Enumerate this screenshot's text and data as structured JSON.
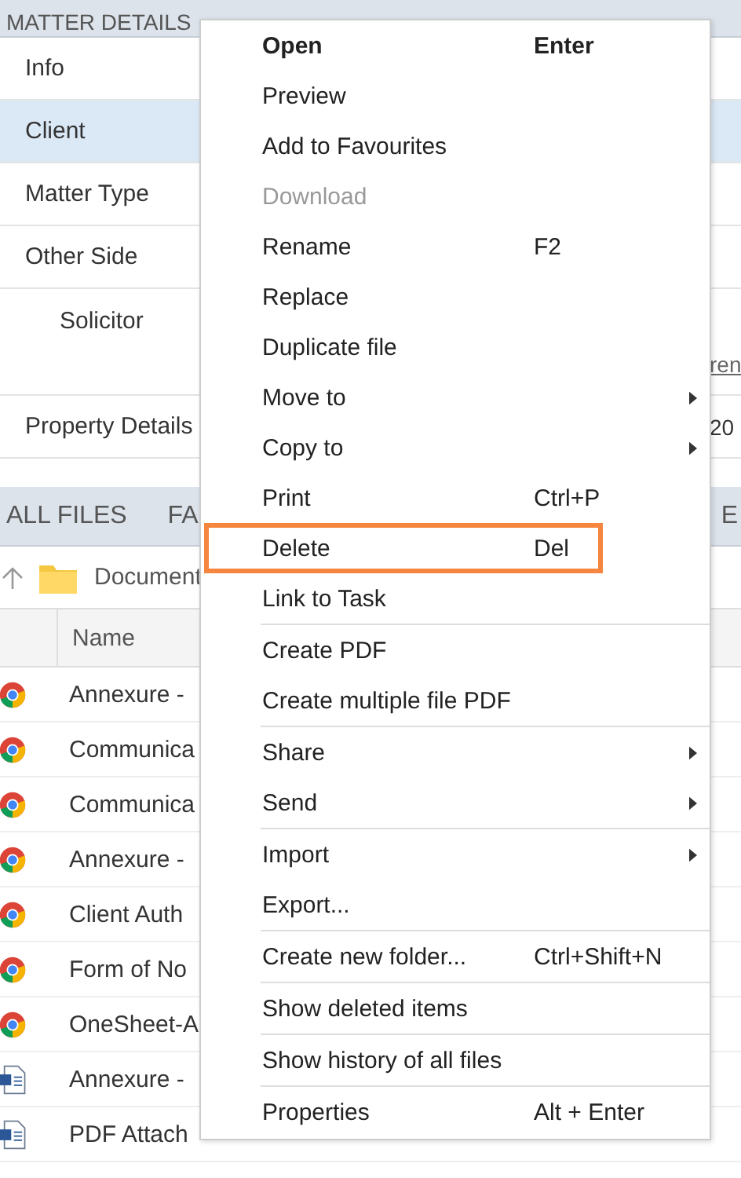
{
  "matter_details": {
    "title": "MATTER DETAILS",
    "rows": [
      {
        "label": "Info",
        "selected": false
      },
      {
        "label": "Client",
        "selected": true
      },
      {
        "label": "Matter Type",
        "selected": false
      },
      {
        "label": "Other Side",
        "selected": false
      },
      {
        "label": "Solicitor",
        "selected": false,
        "kind": "sub",
        "value": "ren",
        "underlined": true
      },
      {
        "label": "Property Details",
        "selected": false,
        "kind": "main",
        "value": "20",
        "underlined": false
      }
    ]
  },
  "files": {
    "tabs": [
      {
        "label": "ALL FILES",
        "selected": false
      },
      {
        "label": "FA",
        "selected": false
      },
      {
        "label": "E",
        "selected": false
      }
    ],
    "breadcrumb": "Document",
    "columns": [
      "Name"
    ],
    "rows": [
      {
        "name": "Annexure -",
        "kind": "browser"
      },
      {
        "name": "Communica",
        "kind": "browser"
      },
      {
        "name": "Communica",
        "kind": "browser"
      },
      {
        "name": "Annexure -",
        "kind": "browser"
      },
      {
        "name": "Client Auth",
        "kind": "browser"
      },
      {
        "name": "Form of No",
        "kind": "browser"
      },
      {
        "name": "OneSheet-A",
        "kind": "browser"
      },
      {
        "name": "Annexure -",
        "kind": "word"
      },
      {
        "name": "PDF Attach",
        "kind": "word"
      }
    ]
  },
  "context_menu": {
    "groups": [
      [
        {
          "label": "Open",
          "shortcut": "Enter",
          "default": true,
          "disabled": false,
          "submenu": false,
          "highlighted": false
        },
        {
          "label": "Preview",
          "default": false,
          "disabled": false,
          "submenu": false,
          "highlighted": false
        },
        {
          "label": "Add to Favourites",
          "default": false,
          "disabled": false,
          "submenu": false,
          "highlighted": false
        },
        {
          "label": "Download",
          "default": false,
          "disabled": true,
          "submenu": false,
          "highlighted": false
        },
        {
          "label": "Rename",
          "shortcut": "F2",
          "default": false,
          "disabled": false,
          "submenu": false,
          "highlighted": false
        },
        {
          "label": "Replace",
          "default": false,
          "disabled": false,
          "submenu": false,
          "highlighted": false
        },
        {
          "label": "Duplicate file",
          "default": false,
          "disabled": false,
          "submenu": false,
          "highlighted": false
        },
        {
          "label": "Move to",
          "default": false,
          "disabled": false,
          "submenu": true,
          "highlighted": false
        },
        {
          "label": "Copy to",
          "default": false,
          "disabled": false,
          "submenu": true,
          "highlighted": false
        },
        {
          "label": "Print",
          "shortcut": "Ctrl+P",
          "default": false,
          "disabled": false,
          "submenu": false,
          "highlighted": false
        },
        {
          "label": "Delete",
          "shortcut": "Del",
          "default": false,
          "disabled": false,
          "submenu": false,
          "highlighted": true
        },
        {
          "label": "Link to Task",
          "default": false,
          "disabled": false,
          "submenu": false,
          "highlighted": false
        }
      ],
      [
        {
          "label": "Create PDF",
          "default": false,
          "disabled": false,
          "submenu": false,
          "highlighted": false
        },
        {
          "label": "Create multiple file PDF",
          "default": false,
          "disabled": false,
          "submenu": false,
          "highlighted": false
        }
      ],
      [
        {
          "label": "Share",
          "default": false,
          "disabled": false,
          "submenu": true,
          "highlighted": false
        },
        {
          "label": "Send",
          "default": false,
          "disabled": false,
          "submenu": true,
          "highlighted": false
        }
      ],
      [
        {
          "label": "Import",
          "default": false,
          "disabled": false,
          "submenu": true,
          "highlighted": false
        },
        {
          "label": "Export...",
          "default": false,
          "disabled": false,
          "submenu": false,
          "highlighted": false
        }
      ],
      [
        {
          "label": "Create new folder...",
          "shortcut": "Ctrl+Shift+N",
          "default": false,
          "disabled": false,
          "submenu": false,
          "highlighted": false
        }
      ],
      [
        {
          "label": "Show deleted items",
          "default": false,
          "disabled": false,
          "submenu": false,
          "highlighted": false
        }
      ],
      [
        {
          "label": "Show history of all files",
          "default": false,
          "disabled": false,
          "submenu": false,
          "highlighted": false
        }
      ],
      [
        {
          "label": "Properties",
          "shortcut": "Alt + Enter",
          "default": false,
          "disabled": false,
          "submenu": false,
          "highlighted": false
        }
      ]
    ]
  }
}
